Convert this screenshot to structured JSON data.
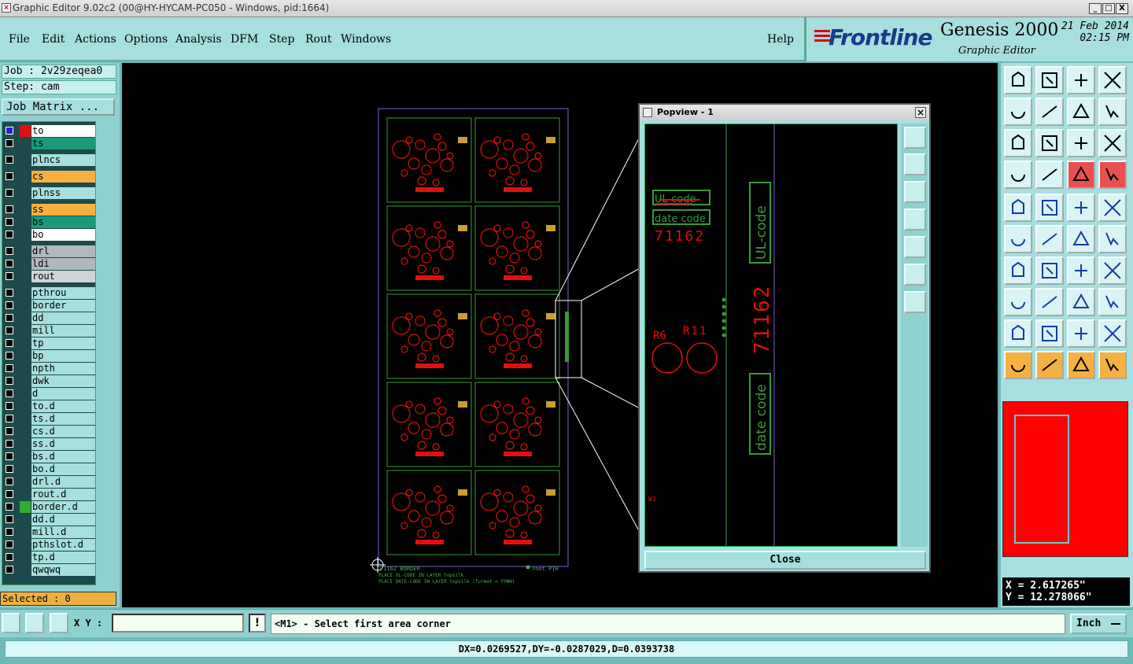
{
  "window": {
    "title": "Graphic Editor 9.02c2 (00@HY-HYCAM-PC050 - Windows, pid:1664)",
    "buttons": [
      "_",
      "□",
      "X"
    ]
  },
  "menu": {
    "items": [
      "File",
      "Edit",
      "Actions",
      "Options",
      "Analysis",
      "DFM",
      "Step",
      "Rout",
      "Windows"
    ],
    "help": "Help"
  },
  "brand": {
    "logo": "Frontline",
    "product": "Genesis 2000",
    "subtitle": "Graphic Editor",
    "date": "21 Feb 2014",
    "time": "02:15 PM",
    "colors": {
      "logo": "#1a3a8a",
      "accent": "#d01010"
    }
  },
  "job": {
    "job_label": "Job : 2v29zeqea0",
    "step_label": "Step: cam",
    "matrix_button": "Job Matrix ..."
  },
  "layers": [
    {
      "name": "to",
      "color": "#ffffff",
      "group": 0
    },
    {
      "name": "ts",
      "color": "#1a9a7a",
      "group": 0
    },
    {
      "name": "plncs",
      "color": "#a7dede",
      "group": 1
    },
    {
      "name": "cs",
      "color": "#f6b040",
      "group": 2
    },
    {
      "name": "plnss",
      "color": "#a7dede",
      "group": 3
    },
    {
      "name": "ss",
      "color": "#f6b040",
      "group": 4
    },
    {
      "name": "bs",
      "color": "#1a9a7a",
      "group": 4
    },
    {
      "name": "bo",
      "color": "#ffffff",
      "group": 4
    },
    {
      "name": "drl",
      "color": "#b0b8c0",
      "group": 5
    },
    {
      "name": "ldi",
      "color": "#b0b8c0",
      "group": 5
    },
    {
      "name": "rout",
      "color": "#d0d4d8",
      "group": 5
    },
    {
      "name": "pthrou",
      "color": "#a7dede",
      "group": 6
    },
    {
      "name": "border",
      "color": "#a7dede",
      "group": 6
    },
    {
      "name": "dd",
      "color": "#a7dede",
      "group": 6
    },
    {
      "name": "mill",
      "color": "#a7dede",
      "group": 6
    },
    {
      "name": "tp",
      "color": "#a7dede",
      "group": 6
    },
    {
      "name": "bp",
      "color": "#a7dede",
      "group": 6
    },
    {
      "name": "npth",
      "color": "#a7dede",
      "group": 6
    },
    {
      "name": "dwk",
      "color": "#a7dede",
      "group": 6
    },
    {
      "name": "d",
      "color": "#a7dede",
      "group": 6
    },
    {
      "name": "to.d",
      "color": "#a7dede",
      "group": 6
    },
    {
      "name": "ts.d",
      "color": "#a7dede",
      "group": 6
    },
    {
      "name": "cs.d",
      "color": "#a7dede",
      "group": 6
    },
    {
      "name": "ss.d",
      "color": "#a7dede",
      "group": 6
    },
    {
      "name": "bs.d",
      "color": "#a7dede",
      "group": 6
    },
    {
      "name": "bo.d",
      "color": "#a7dede",
      "group": 6
    },
    {
      "name": "drl.d",
      "color": "#a7dede",
      "group": 6
    },
    {
      "name": "rout.d",
      "color": "#a7dede",
      "group": 6
    },
    {
      "name": "border.d",
      "color": "#a7dede",
      "group": 6
    },
    {
      "name": "dd.d",
      "color": "#a7dede",
      "group": 6
    },
    {
      "name": "mill.d",
      "color": "#a7dede",
      "group": 6
    },
    {
      "name": "pthslot.d",
      "color": "#a7dede",
      "group": 6
    },
    {
      "name": "tp.d",
      "color": "#a7dede",
      "group": 6
    },
    {
      "name": "qwqwq",
      "color": "#a7dede",
      "group": 6
    }
  ],
  "selected": "Selected : 0",
  "board": {
    "footer_line1": "71162  BORDER",
    "footer_line2": "PLACE UL-CODE IN LAYER topsilk",
    "footer_line3": "PLACE DATE-CODE IN LAYER topsilk (format = YYWW)",
    "legend": "=not PTH"
  },
  "popview": {
    "title": "Popview - 1",
    "close": "Close",
    "label_ul": "UL-code",
    "label_date": "date code",
    "part_number": "71162",
    "ref_r6": "R6",
    "ref_r11": "R11",
    "ref_w3": "W3",
    "vertical_ul": "UL-code",
    "vertical_pn": "71162",
    "vertical_date": "date code"
  },
  "coords": {
    "x": "X = 2.617265\"",
    "y": "Y = 12.278066\""
  },
  "command": {
    "xy_label": "X Y :",
    "xy_value": "",
    "prompt": "<M1> - Select first area corner",
    "units": "Inch"
  },
  "status": "DX=0.0269527,DY=-0.0287029,D=0.0393738"
}
